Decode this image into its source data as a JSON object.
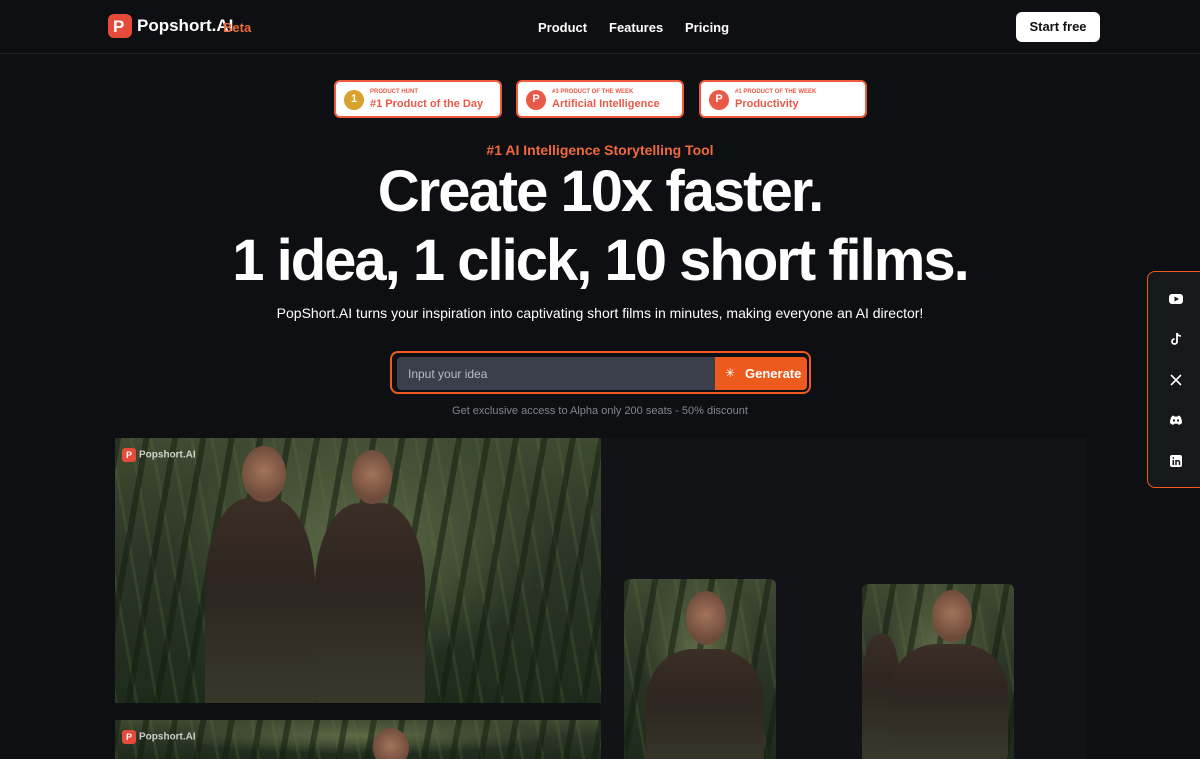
{
  "brand": {
    "logo_letter": "P",
    "name": "Popshort.AI",
    "tag": "Beta"
  },
  "nav": {
    "links": [
      "Product",
      "Features",
      "Pricing"
    ],
    "cta": "Start free"
  },
  "badges": [
    {
      "small": "PRODUCT HUNT",
      "big": "#1 Product of the Day",
      "icon": "medal-icon"
    },
    {
      "small": "#3 PRODUCT OF THE WEEK",
      "big": "Artificial Intelligence",
      "icon": "producthunt-icon"
    },
    {
      "small": "#1 PRODUCT OF THE WEEK",
      "big": "Productivity",
      "icon": "producthunt-icon"
    }
  ],
  "hero": {
    "eyebrow": "#1 AI Intelligence Storytelling Tool",
    "headline_1": "Create 10x faster.",
    "headline_2": "1 idea, 1 click, 10 short films.",
    "subline": "PopShort.AI turns your inspiration into captivating short films in minutes, making everyone an AI director!"
  },
  "idea_form": {
    "placeholder": "Input your idea",
    "value": "",
    "button": "Generate",
    "note": "Get exclusive access to Alpha only 200 seats - 50% discount"
  },
  "gallery": {
    "watermark": "Popshort.AI"
  },
  "social": [
    "youtube-icon",
    "tiktok-icon",
    "x-icon",
    "discord-icon",
    "linkedin-icon"
  ],
  "colors": {
    "accent": "#ec5a1d",
    "background": "#0e0f12",
    "badge_red": "#e85a47"
  }
}
